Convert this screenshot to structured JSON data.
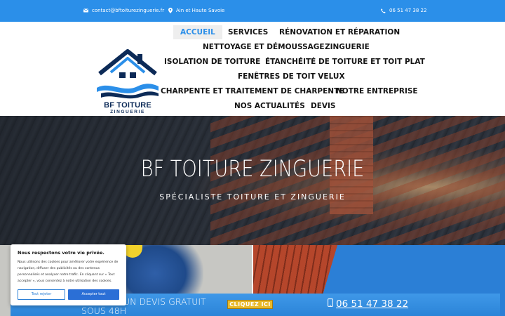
{
  "topbar": {
    "email": "contact@bftoiturezinguerie.fr",
    "area": "Ain et Haute Savoie",
    "phone": "06 51 47 38 22",
    "icons": [
      "envelope-icon",
      "location-pin-icon",
      "phone-icon"
    ]
  },
  "logo": {
    "line1": "BF TOITURE",
    "line2": "ZINGUERIE"
  },
  "nav": {
    "accueil": "ACCUEIL",
    "services": "SERVICES",
    "renovation": "RÉNOVATION ET RÉPARATION",
    "nettoyage": "NETTOYAGE ET DÉMOUSSAGE",
    "zinguerie": "ZINGUERIE",
    "isolation": "ISOLATION DE TOITURE",
    "etancheite": "ÉTANCHÉITÉ DE TOITURE ET TOIT PLAT",
    "fenetres": "FENÊTRES DE TOIT VELUX",
    "charpente": "CHARPENTE ET TRAITEMENT DE CHARPENTE",
    "entreprise": "NOTRE ENTREPRISE",
    "actualites": "NOS ACTUALITÉS",
    "devis": "DEVIS",
    "active": "ACCUEIL"
  },
  "hero": {
    "title": "BF TOITURE ZINGUERIE",
    "subtitle": "SPÉCIALISTE TOITURE ET ZINGUERIE"
  },
  "cta": {
    "line1": "UN DEVIS GRATUIT",
    "line2": "SOUS 48H",
    "button": "CLIQUEZ ICI",
    "phone": "06 51 47 38 22"
  },
  "cookie": {
    "title": "Nous respectons votre vie privée.",
    "body": "Nous utilisons des cookies pour améliorer votre expérience de navigation, diffuser des publicités ou des contenus personnalisés et analyser notre trafic. En cliquant sur « Tout accepter », vous consentez à notre utilisation des cookies.",
    "reject": "Tout rejeter",
    "accept": "Accepter tout"
  },
  "colors": {
    "brand_blue": "#2b8fe9",
    "cta_yellow": "#e9b92a",
    "logo_navy": "#0c2a57"
  }
}
